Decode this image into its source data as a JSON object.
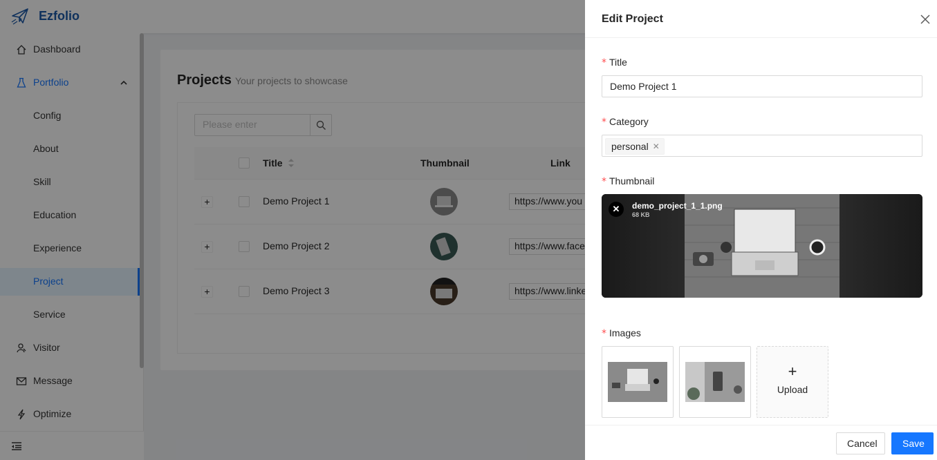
{
  "app": {
    "name": "Ezfolio"
  },
  "sidebar": {
    "items": [
      {
        "label": "Dashboard",
        "icon": "home-icon"
      },
      {
        "label": "Portfolio",
        "icon": "flask-icon"
      },
      {
        "label": "Config"
      },
      {
        "label": "About"
      },
      {
        "label": "Skill"
      },
      {
        "label": "Education"
      },
      {
        "label": "Experience"
      },
      {
        "label": "Project"
      },
      {
        "label": "Service"
      },
      {
        "label": "Visitor",
        "icon": "visitor-icon"
      },
      {
        "label": "Message",
        "icon": "mail-icon"
      },
      {
        "label": "Optimize",
        "icon": "bolt-icon"
      }
    ]
  },
  "page": {
    "title": "Projects",
    "subtitle": "Your projects to showcase"
  },
  "search": {
    "placeholder": "Please enter"
  },
  "table": {
    "headers": {
      "title": "Title",
      "thumbnail": "Thumbnail",
      "link": "Link"
    },
    "rows": [
      {
        "title": "Demo Project 1",
        "link": "https://www.you"
      },
      {
        "title": "Demo Project 2",
        "link": "https://www.face"
      },
      {
        "title": "Demo Project 3",
        "link": "https://www.linke"
      }
    ]
  },
  "drawer": {
    "title": "Edit Project",
    "fields": {
      "title_label": "Title",
      "title_value": "Demo Project 1",
      "category_label": "Category",
      "category_tag": "personal",
      "thumbnail_label": "Thumbnail",
      "thumbnail_file": "demo_project_1_1.png",
      "thumbnail_size": "68 KB",
      "images_label": "Images",
      "upload_label": "Upload"
    },
    "required_mark": "*",
    "cancel": "Cancel",
    "save": "Save"
  },
  "colors": {
    "primary": "#1677ff",
    "brand": "#1d59a8",
    "required": "#ff4d4f"
  }
}
